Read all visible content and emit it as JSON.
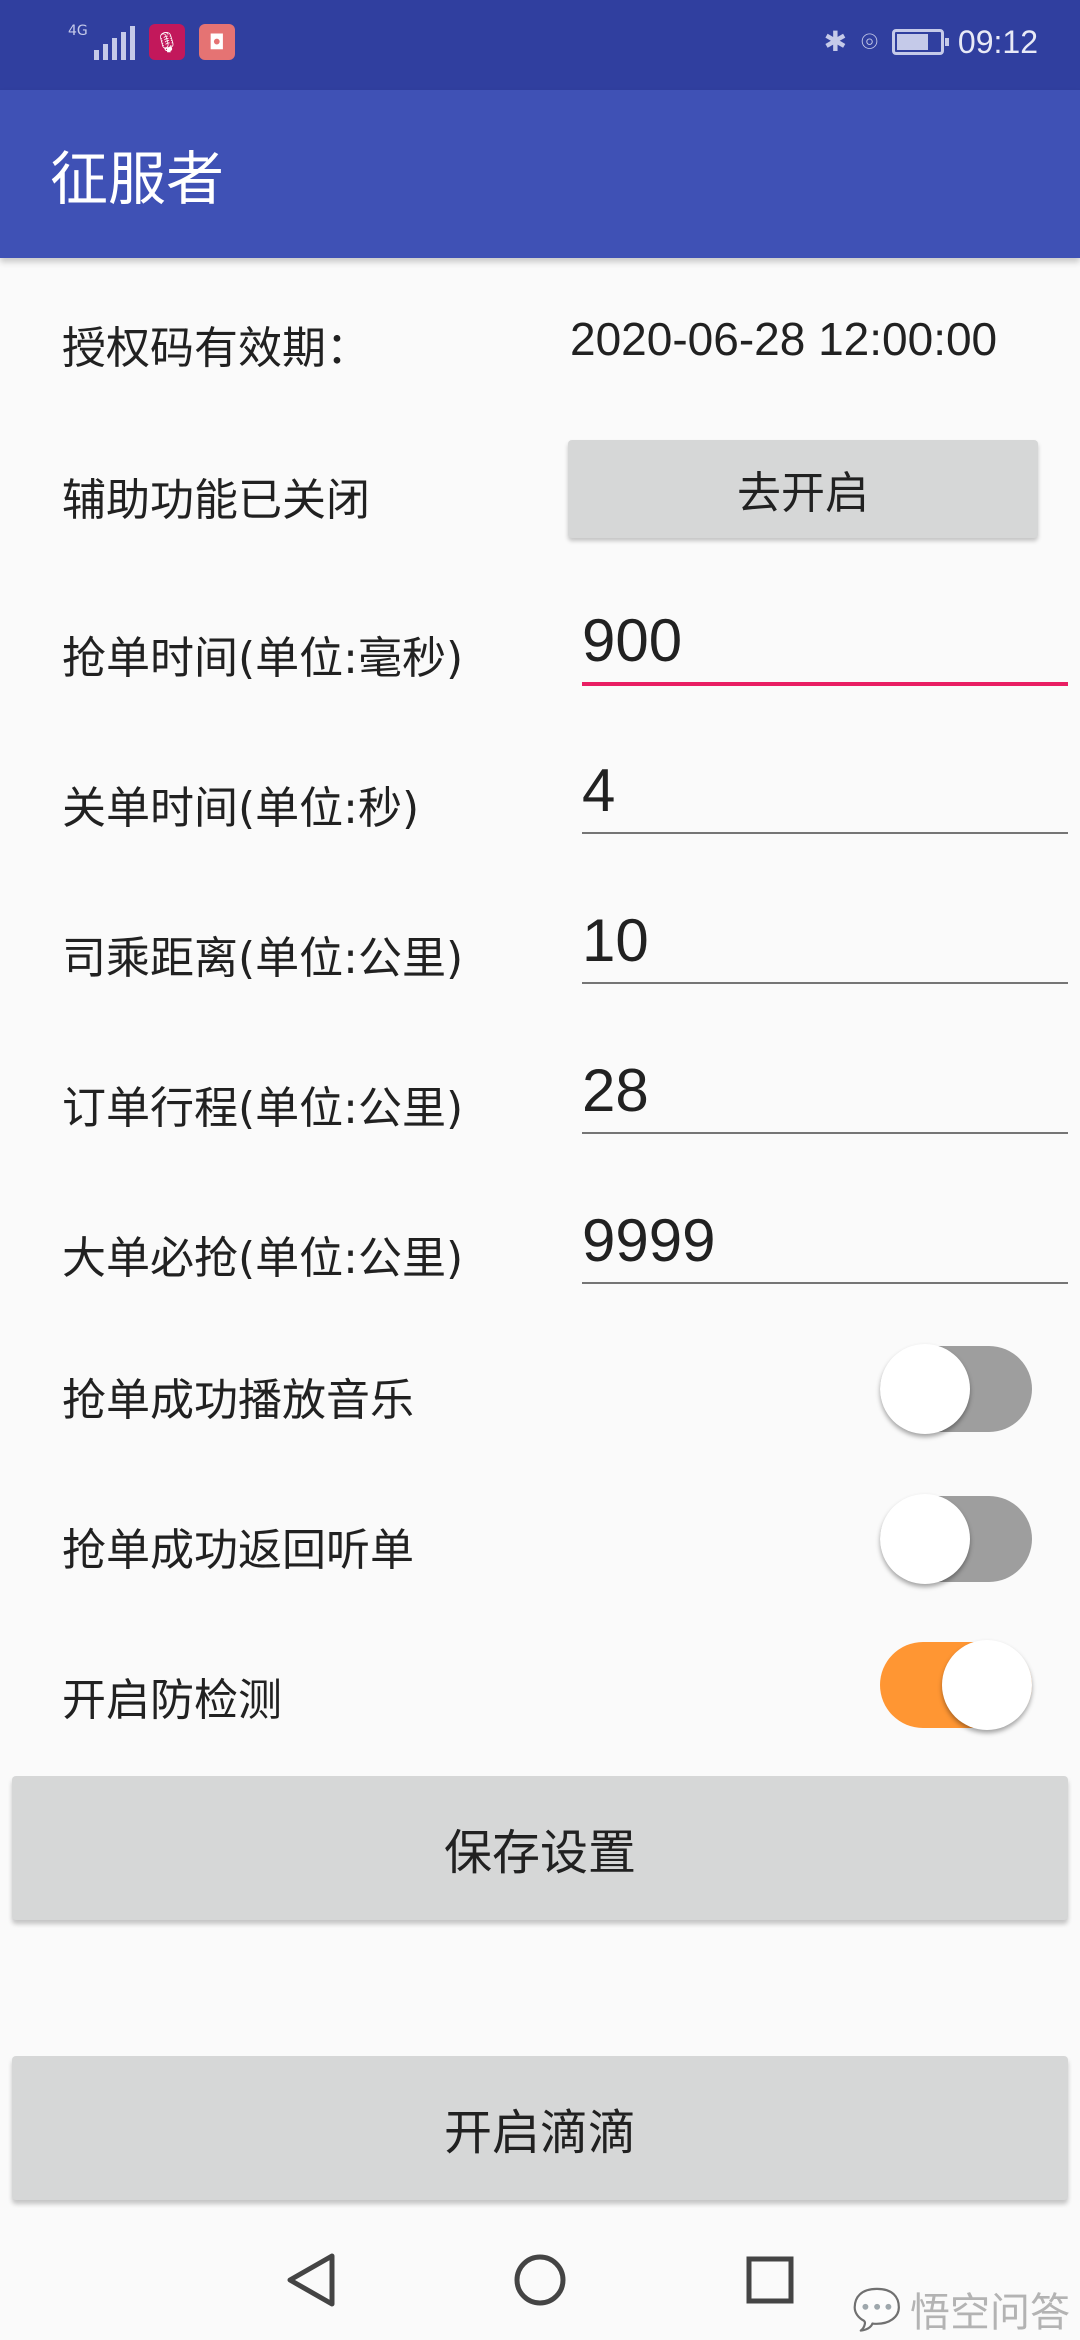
{
  "status_bar": {
    "network": "4G",
    "time": "09:12",
    "battery_level": 0.7,
    "icons": [
      "signal-icon",
      "mic-app-icon",
      "didi-app-icon",
      "bluetooth-icon",
      "location-icon",
      "battery-icon"
    ]
  },
  "app_bar": {
    "title": "征服者"
  },
  "form": {
    "license": {
      "label": "授权码有效期：",
      "value": "2020-06-28 12:00:00"
    },
    "accessibility": {
      "label": "辅助功能已关闭",
      "button": "去开启"
    },
    "grab_time": {
      "label": "抢单时间(单位:毫秒)",
      "value": "900"
    },
    "close_time": {
      "label": "关单时间(单位:秒)",
      "value": "4"
    },
    "driver_distance": {
      "label": "司乘距离(单位:公里)",
      "value": "10"
    },
    "trip_distance": {
      "label": "订单行程(单位:公里)",
      "value": "28"
    },
    "big_order": {
      "label": "大单必抢(单位:公里)",
      "value": "9999"
    },
    "play_music": {
      "label": "抢单成功播放音乐",
      "checked": false
    },
    "return_listen": {
      "label": "抢单成功返回听单",
      "checked": false
    },
    "anti_detect": {
      "label": "开启防检测",
      "checked": true
    }
  },
  "buttons": {
    "save": "保存设置",
    "open_didi": "开启滴滴"
  },
  "watermark": "悟空问答",
  "colors": {
    "status_bar": "#303f9f",
    "app_bar": "#3f51b5",
    "accent": "#e91e63",
    "switch_on": "#ff9633"
  }
}
